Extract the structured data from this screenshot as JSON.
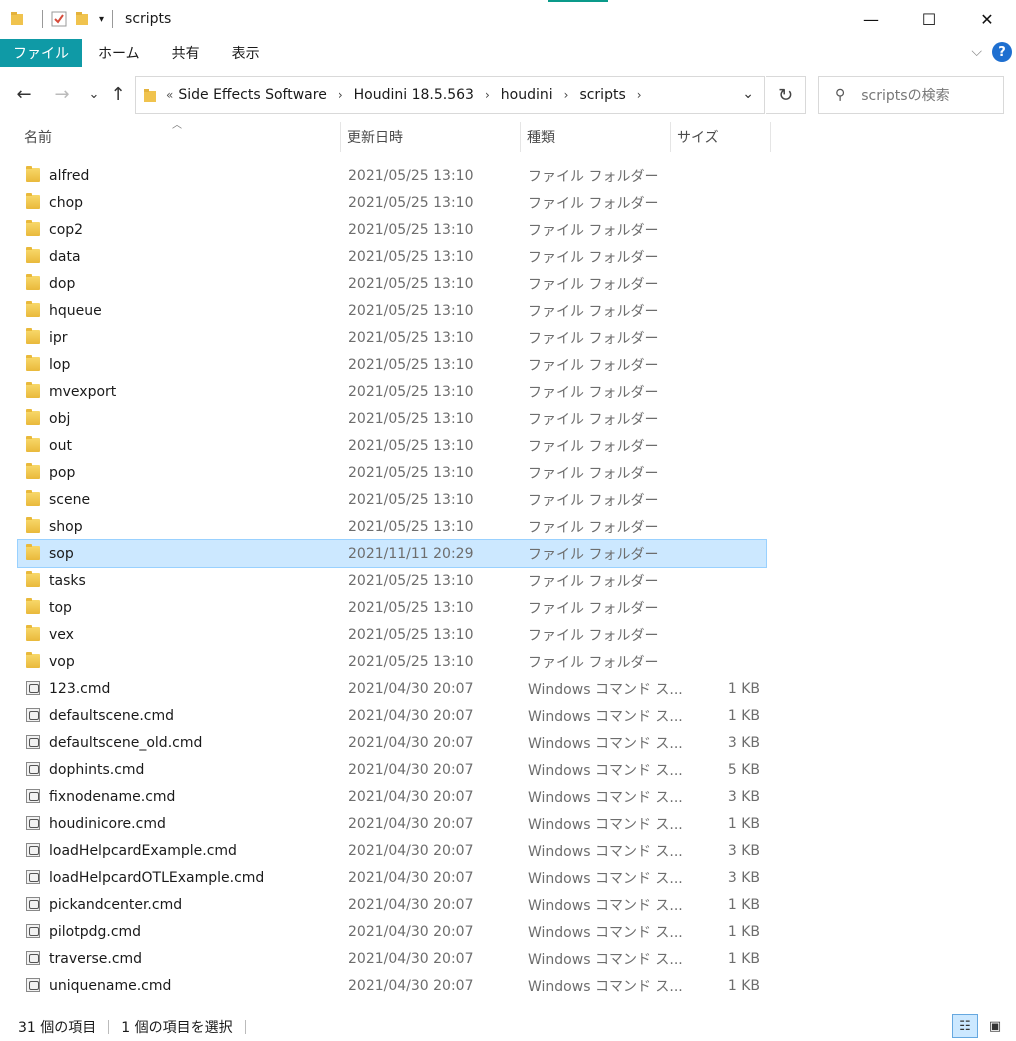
{
  "window": {
    "title": "scripts",
    "minimize": "—",
    "maximize": "☐",
    "close": "✕"
  },
  "ribbon": {
    "tabs": [
      "ファイル",
      "ホーム",
      "共有",
      "表示"
    ]
  },
  "nav": {
    "back": "←",
    "forward": "→",
    "recent": "⌄",
    "up": "↑",
    "overflow": "«",
    "breadcrumb": [
      "Side Effects Software",
      "Houdini 18.5.563",
      "houdini",
      "scripts"
    ],
    "refresh": "↻",
    "search_placeholder": "scriptsの検索"
  },
  "columns": {
    "name": "名前",
    "date": "更新日時",
    "type": "種類",
    "size": "サイズ"
  },
  "files": [
    {
      "name": "alfred",
      "date": "2021/05/25 13:10",
      "type": "ファイル フォルダー",
      "size": "",
      "kind": "folder"
    },
    {
      "name": "chop",
      "date": "2021/05/25 13:10",
      "type": "ファイル フォルダー",
      "size": "",
      "kind": "folder"
    },
    {
      "name": "cop2",
      "date": "2021/05/25 13:10",
      "type": "ファイル フォルダー",
      "size": "",
      "kind": "folder"
    },
    {
      "name": "data",
      "date": "2021/05/25 13:10",
      "type": "ファイル フォルダー",
      "size": "",
      "kind": "folder"
    },
    {
      "name": "dop",
      "date": "2021/05/25 13:10",
      "type": "ファイル フォルダー",
      "size": "",
      "kind": "folder"
    },
    {
      "name": "hqueue",
      "date": "2021/05/25 13:10",
      "type": "ファイル フォルダー",
      "size": "",
      "kind": "folder"
    },
    {
      "name": "ipr",
      "date": "2021/05/25 13:10",
      "type": "ファイル フォルダー",
      "size": "",
      "kind": "folder"
    },
    {
      "name": "lop",
      "date": "2021/05/25 13:10",
      "type": "ファイル フォルダー",
      "size": "",
      "kind": "folder"
    },
    {
      "name": "mvexport",
      "date": "2021/05/25 13:10",
      "type": "ファイル フォルダー",
      "size": "",
      "kind": "folder"
    },
    {
      "name": "obj",
      "date": "2021/05/25 13:10",
      "type": "ファイル フォルダー",
      "size": "",
      "kind": "folder"
    },
    {
      "name": "out",
      "date": "2021/05/25 13:10",
      "type": "ファイル フォルダー",
      "size": "",
      "kind": "folder"
    },
    {
      "name": "pop",
      "date": "2021/05/25 13:10",
      "type": "ファイル フォルダー",
      "size": "",
      "kind": "folder"
    },
    {
      "name": "scene",
      "date": "2021/05/25 13:10",
      "type": "ファイル フォルダー",
      "size": "",
      "kind": "folder"
    },
    {
      "name": "shop",
      "date": "2021/05/25 13:10",
      "type": "ファイル フォルダー",
      "size": "",
      "kind": "folder"
    },
    {
      "name": "sop",
      "date": "2021/11/11 20:29",
      "type": "ファイル フォルダー",
      "size": "",
      "kind": "folder",
      "selected": true
    },
    {
      "name": "tasks",
      "date": "2021/05/25 13:10",
      "type": "ファイル フォルダー",
      "size": "",
      "kind": "folder"
    },
    {
      "name": "top",
      "date": "2021/05/25 13:10",
      "type": "ファイル フォルダー",
      "size": "",
      "kind": "folder"
    },
    {
      "name": "vex",
      "date": "2021/05/25 13:10",
      "type": "ファイル フォルダー",
      "size": "",
      "kind": "folder"
    },
    {
      "name": "vop",
      "date": "2021/05/25 13:10",
      "type": "ファイル フォルダー",
      "size": "",
      "kind": "folder"
    },
    {
      "name": "123.cmd",
      "date": "2021/04/30 20:07",
      "type": "Windows コマンド ス...",
      "size": "1 KB",
      "kind": "cmd"
    },
    {
      "name": "defaultscene.cmd",
      "date": "2021/04/30 20:07",
      "type": "Windows コマンド ス...",
      "size": "1 KB",
      "kind": "cmd"
    },
    {
      "name": "defaultscene_old.cmd",
      "date": "2021/04/30 20:07",
      "type": "Windows コマンド ス...",
      "size": "3 KB",
      "kind": "cmd"
    },
    {
      "name": "dophints.cmd",
      "date": "2021/04/30 20:07",
      "type": "Windows コマンド ス...",
      "size": "5 KB",
      "kind": "cmd"
    },
    {
      "name": "fixnodename.cmd",
      "date": "2021/04/30 20:07",
      "type": "Windows コマンド ス...",
      "size": "3 KB",
      "kind": "cmd"
    },
    {
      "name": "houdinicore.cmd",
      "date": "2021/04/30 20:07",
      "type": "Windows コマンド ス...",
      "size": "1 KB",
      "kind": "cmd"
    },
    {
      "name": "loadHelpcardExample.cmd",
      "date": "2021/04/30 20:07",
      "type": "Windows コマンド ス...",
      "size": "3 KB",
      "kind": "cmd"
    },
    {
      "name": "loadHelpcardOTLExample.cmd",
      "date": "2021/04/30 20:07",
      "type": "Windows コマンド ス...",
      "size": "3 KB",
      "kind": "cmd"
    },
    {
      "name": "pickandcenter.cmd",
      "date": "2021/04/30 20:07",
      "type": "Windows コマンド ス...",
      "size": "1 KB",
      "kind": "cmd"
    },
    {
      "name": "pilotpdg.cmd",
      "date": "2021/04/30 20:07",
      "type": "Windows コマンド ス...",
      "size": "1 KB",
      "kind": "cmd"
    },
    {
      "name": "traverse.cmd",
      "date": "2021/04/30 20:07",
      "type": "Windows コマンド ス...",
      "size": "1 KB",
      "kind": "cmd"
    },
    {
      "name": "uniquename.cmd",
      "date": "2021/04/30 20:07",
      "type": "Windows コマンド ス...",
      "size": "1 KB",
      "kind": "cmd"
    }
  ],
  "status": {
    "count": "31 個の項目",
    "selected": "1 個の項目を選択"
  },
  "colors": {
    "file_tab": "#0f9aa6",
    "selection": "#cce8ff",
    "help": "#1e6fd0"
  }
}
